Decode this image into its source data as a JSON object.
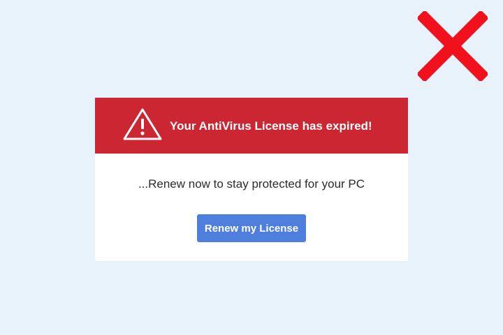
{
  "colors": {
    "page_background": "#e8f2fa",
    "header_red": "#cc2633",
    "close_x_red": "#f0111d",
    "button_blue": "#4f7fdd",
    "dialog_background": "#ffffff"
  },
  "close": {
    "icon": "close-icon"
  },
  "dialog": {
    "header": {
      "icon": "warning-triangle-icon",
      "title": "Your AntiVirus License has expired!"
    },
    "message": "...Renew now to stay protected for your PC",
    "button_label": "Renew my License"
  }
}
